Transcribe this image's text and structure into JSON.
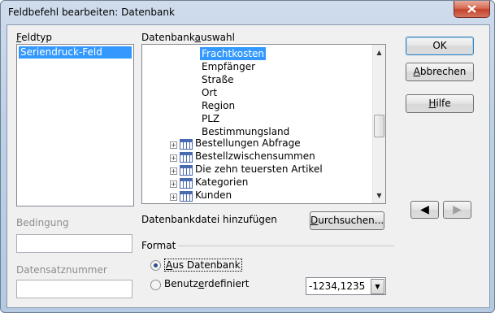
{
  "window": {
    "title": "Feldbefehl bearbeiten: Datenbank",
    "close_glyph": "✕"
  },
  "feldtyp": {
    "label": "Feldtyp",
    "items": [
      "Seriendruck-Feld"
    ]
  },
  "datenbank": {
    "label": "Datenbankauswahl",
    "fields": [
      "Frachtkosten",
      "Empfänger",
      "Straße",
      "Ort",
      "Region",
      "PLZ",
      "Bestimmungsland"
    ],
    "tables": [
      "Bestellungen Abfrage",
      "Bestellzwischensummen",
      "Die zehn teuersten Artikel",
      "Kategorien",
      "Kunden"
    ]
  },
  "add_db": {
    "label": "Datenbankdatei hinzufügen",
    "browse_button": "Durchsuchen..."
  },
  "condition": {
    "label": "Bedingung",
    "value": ""
  },
  "record_no": {
    "label": "Datensatznummer",
    "value": ""
  },
  "format": {
    "label": "Format",
    "option_db": "Aus Datenbank",
    "option_custom": "Benutzerdefiniert",
    "custom_value": "-1234,1235"
  },
  "buttons": {
    "ok": "OK",
    "cancel": "Abbrechen",
    "help": "Hilfe"
  },
  "nav": {
    "prev": "◀",
    "next": "▶"
  }
}
